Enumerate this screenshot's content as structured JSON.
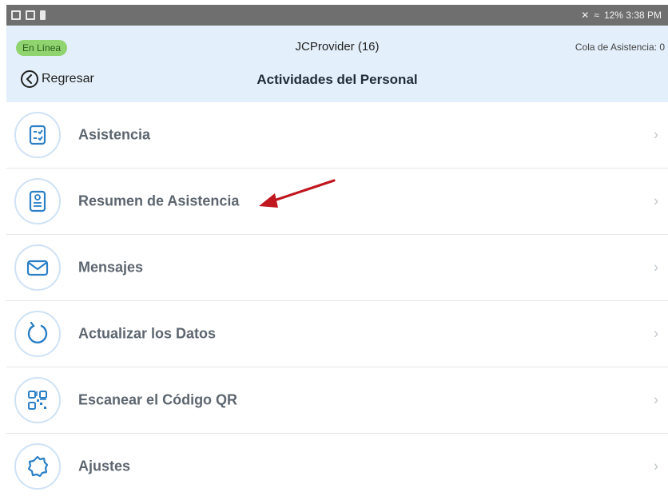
{
  "status_bar": {
    "right_text": "12% 3:38 PM",
    "bg_color": "#6f6f6f"
  },
  "header": {
    "online_badge": "En Línea",
    "app_title": "JCProvider (16)",
    "queue_label": "Cola de Asistencia: 0",
    "back_label": "Regresar",
    "page_title": "Actividades del Personal",
    "bg_color": "#e3effa"
  },
  "menu": {
    "items": [
      {
        "label": "Asistencia",
        "icon": "clipboard-checklist-icon"
      },
      {
        "label": "Resumen de Asistencia",
        "icon": "document-summary-icon"
      },
      {
        "label": "Mensajes",
        "icon": "envelope-icon"
      },
      {
        "label": "Actualizar los Datos",
        "icon": "refresh-icon"
      },
      {
        "label": "Escanear el Código QR",
        "icon": "qr-code-icon"
      },
      {
        "label": "Ajustes",
        "icon": "gear-icon"
      }
    ],
    "chevron": "›"
  },
  "annotation": {
    "arrow_color": "#c0161d",
    "points_to": "Resumen de Asistencia"
  }
}
